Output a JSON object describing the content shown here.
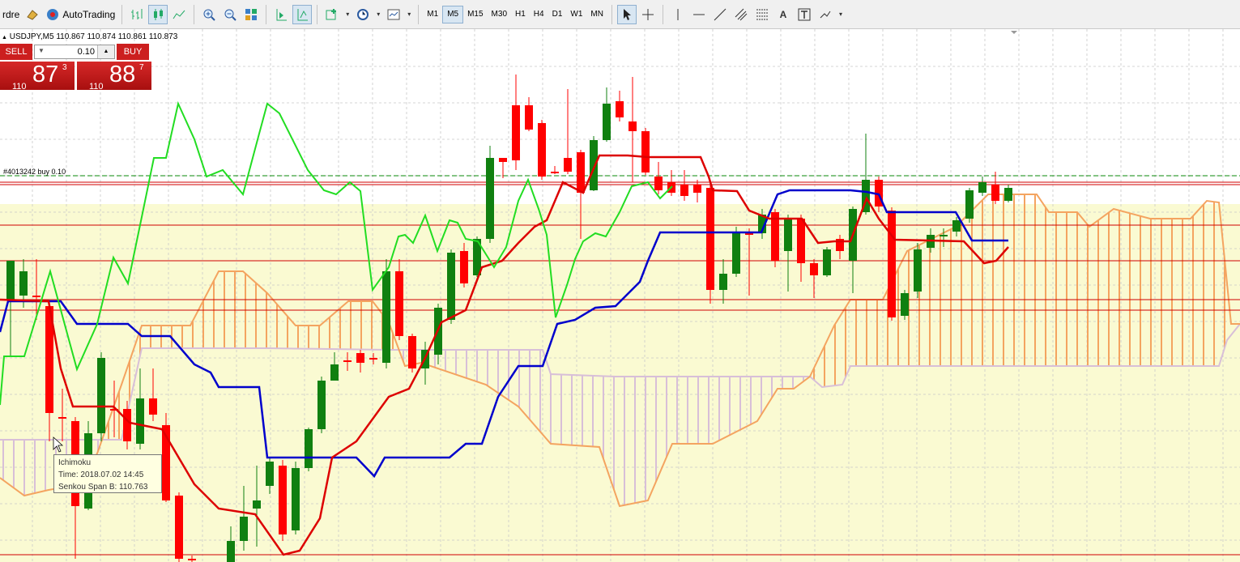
{
  "toolbar": {
    "menu_tail": "rdre",
    "autotrading_label": "AutoTrading",
    "timeframes": [
      "M1",
      "M5",
      "M15",
      "M30",
      "H1",
      "H4",
      "D1",
      "W1",
      "MN"
    ],
    "active_timeframe": "M5",
    "text_tool": "A"
  },
  "chart": {
    "symbol_line": "USDJPY,M5  110.867 110.874 110.861 110.873",
    "order_label": "#4013242 buy 0.10"
  },
  "trade_panel": {
    "sell_label": "SELL",
    "buy_label": "BUY",
    "lot": "0.10",
    "sell_big": "110",
    "sell_main": "87",
    "sell_sup": "3",
    "buy_big": "110",
    "buy_main": "88",
    "buy_sup": "7"
  },
  "tooltip": {
    "line1": "Ichimoku",
    "line2": "Time: 2018.07.02 14:45",
    "line3": "Senkou Span B: 110.763"
  },
  "colors": {
    "bull": "#108010",
    "bear": "#ff0000",
    "tenkan": "#dd0000",
    "kijun": "#0000cc",
    "chikou": "#22dd22",
    "span_a": "#f4a460",
    "span_b": "#d8bfd8",
    "cloud_bg": "#fafad2"
  }
}
